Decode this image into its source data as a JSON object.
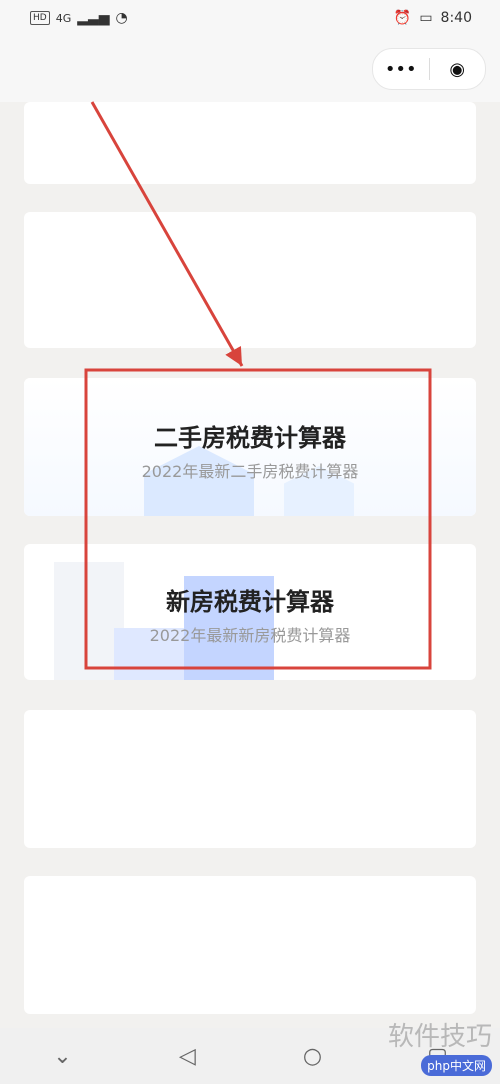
{
  "status_bar": {
    "left_badge": "HD",
    "network": "4G",
    "time": "8:40"
  },
  "title_bar": {
    "more_icon": "more-dots-icon",
    "close_icon": "target-close-icon"
  },
  "cards": [
    {
      "title": "",
      "subtitle": ""
    },
    {
      "title": "",
      "subtitle": ""
    },
    {
      "title": "二手房税费计算器",
      "subtitle": "2022年最新二手房税费计算器"
    },
    {
      "title": "新房税费计算器",
      "subtitle": "2022年最新新房税费计算器"
    },
    {
      "title": "",
      "subtitle": ""
    },
    {
      "title": "",
      "subtitle": ""
    }
  ],
  "annotation": {
    "arrow_color": "#d8443c",
    "box_color": "#d8443c"
  },
  "nav_bar": {
    "icons": [
      "chevron-down-icon",
      "back-triangle-icon",
      "home-circle-icon",
      "recent-square-icon"
    ]
  },
  "watermark": {
    "text": "软件技巧",
    "badge": "php中文网"
  }
}
